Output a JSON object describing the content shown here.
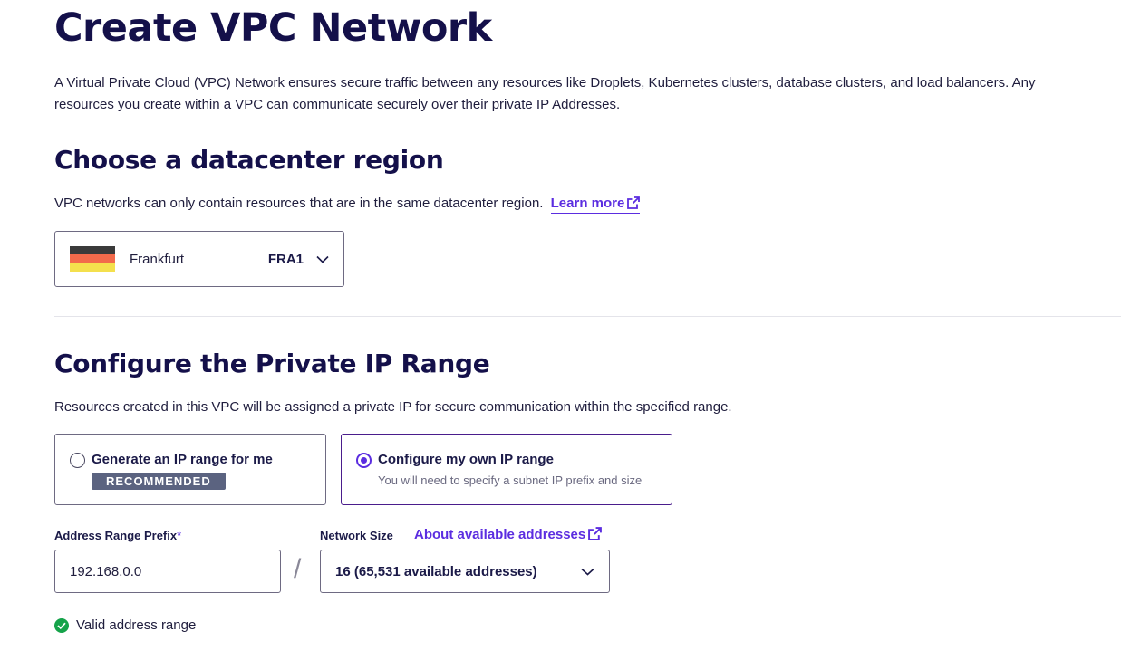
{
  "header": {
    "title": "Create VPC Network",
    "intro": "A Virtual Private Cloud (VPC) Network ensures secure traffic between any resources like Droplets, Kubernetes clusters, database clusters, and load balancers. Any resources you create within a VPC can communicate securely over their private IP Addresses."
  },
  "region": {
    "heading": "Choose a datacenter region",
    "description": "VPC networks can only contain resources that are in the same datacenter region.",
    "learn_more": "Learn more",
    "selected_name": "Frankfurt",
    "selected_code": "FRA1",
    "flag_colors": [
      "#3a3a3a",
      "#f26a4b",
      "#f4e04d"
    ]
  },
  "ip_range": {
    "heading": "Configure the Private IP Range",
    "description": "Resources created in this VPC will be assigned a private IP for secure communication within the specified range.",
    "option_auto": {
      "title": "Generate an IP range for me",
      "badge": "RECOMMENDED"
    },
    "option_own": {
      "title": "Configure my own IP range",
      "subtitle": "You will need to specify a subnet IP prefix and size"
    },
    "prefix_label": "Address Range Prefix",
    "prefix_required": "*",
    "prefix_value": "192.168.0.0",
    "separator": "/",
    "size_label": "Network Size",
    "about_link": "About available addresses",
    "size_value": "16 (65,531 available addresses)",
    "valid_message": "Valid address range"
  },
  "colors": {
    "accent": "#5b2de0",
    "heading": "#14104a",
    "success": "#15a34a",
    "badge": "#5b6380"
  }
}
